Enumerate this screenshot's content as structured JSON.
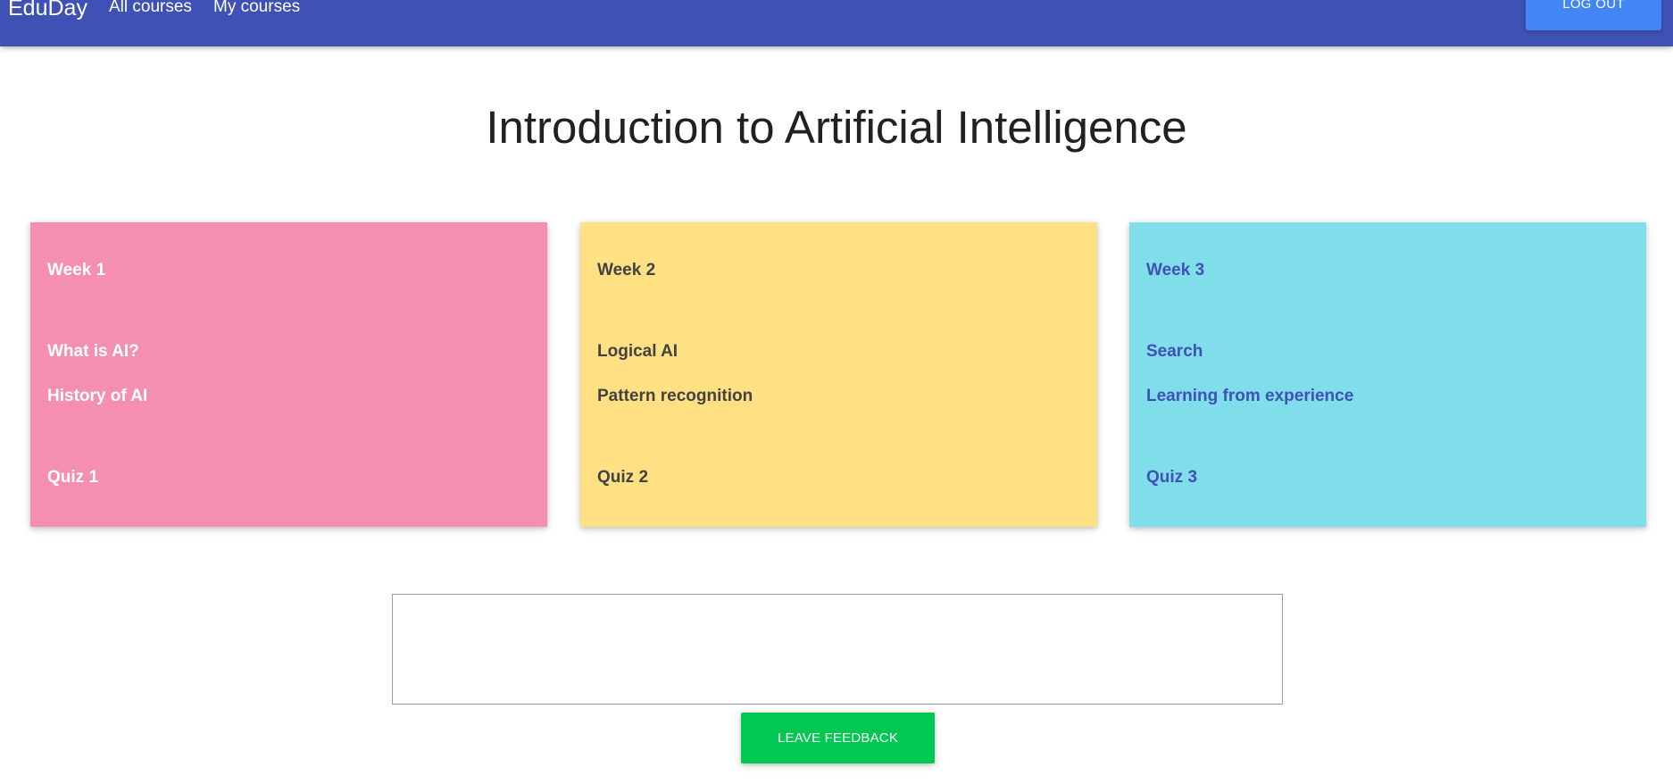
{
  "navbar": {
    "brand": "EduDay",
    "links": [
      "All courses",
      "My courses"
    ],
    "logout_label": "LOG OUT",
    "background": "#3f51b5",
    "logout_color": "#4285f4"
  },
  "page": {
    "title": "Introduction to Artificial Intelligence"
  },
  "cards": [
    {
      "week": "Week 1",
      "lessons": [
        "What is AI?",
        "History of AI"
      ],
      "quiz": "Quiz 1",
      "background": "#f48fb1",
      "text_color": "#ffffff"
    },
    {
      "week": "Week 2",
      "lessons": [
        "Logical AI",
        "Pattern recognition"
      ],
      "quiz": "Quiz 2",
      "background": "#ffe082",
      "text_color": "#424242"
    },
    {
      "week": "Week 3",
      "lessons": [
        "Search",
        "Learning from experience"
      ],
      "quiz": "Quiz 3",
      "background": "#80deea",
      "text_color": "#3f51b5"
    }
  ],
  "feedback": {
    "input_value": "",
    "button_label": "LEAVE FEEDBACK",
    "button_color": "#00c851"
  }
}
